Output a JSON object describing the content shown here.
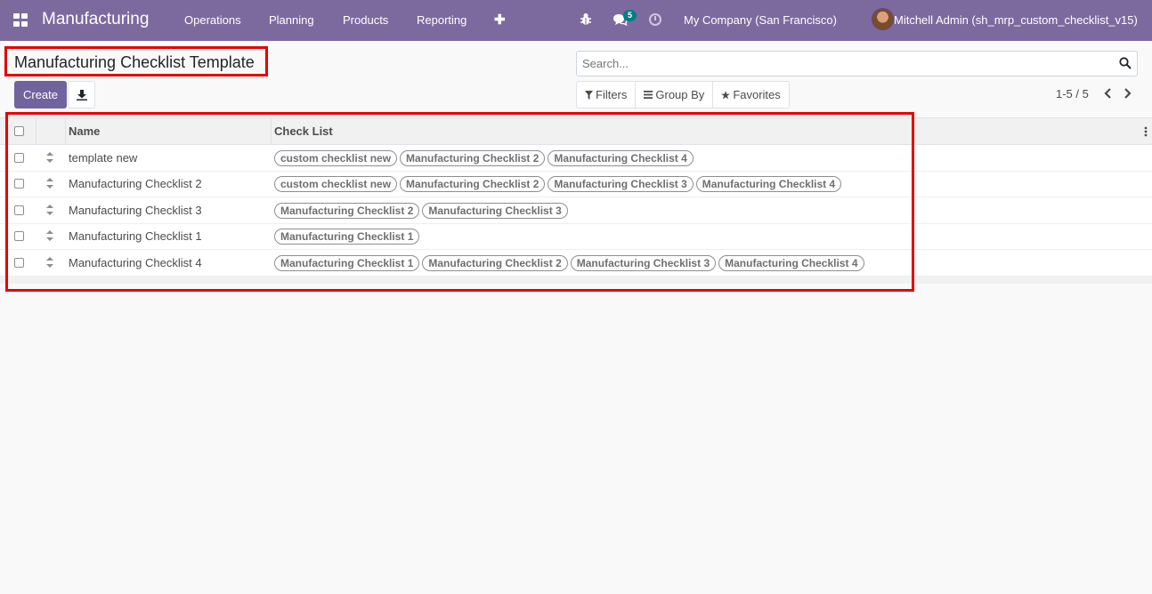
{
  "navbar": {
    "app_name": "Manufacturing",
    "menus": [
      "Operations",
      "Planning",
      "Products",
      "Reporting"
    ],
    "chat_count": "5",
    "company": "My Company (San Francisco)",
    "user": "Mitchell Admin (sh_mrp_custom_checklist_v15)"
  },
  "control_panel": {
    "title": "Manufacturing Checklist Template",
    "create_label": "Create",
    "search_placeholder": "Search...",
    "filters_label": "Filters",
    "group_by_label": "Group By",
    "favorites_label": "Favorites",
    "pager": "1-5 / 5"
  },
  "table": {
    "headers": {
      "name": "Name",
      "checklist": "Check List"
    },
    "rows": [
      {
        "name": "template new",
        "tags": [
          "custom checklist new",
          "Manufacturing Checklist 2",
          "Manufacturing Checklist 4"
        ]
      },
      {
        "name": "Manufacturing Checklist 2",
        "tags": [
          "custom checklist new",
          "Manufacturing Checklist 2",
          "Manufacturing Checklist 3",
          "Manufacturing Checklist 4"
        ]
      },
      {
        "name": "Manufacturing Checklist 3",
        "tags": [
          "Manufacturing Checklist 2",
          "Manufacturing Checklist 3"
        ]
      },
      {
        "name": "Manufacturing Checklist 1",
        "tags": [
          "Manufacturing Checklist 1"
        ]
      },
      {
        "name": "Manufacturing Checklist 4",
        "tags": [
          "Manufacturing Checklist 1",
          "Manufacturing Checklist 2",
          "Manufacturing Checklist 3",
          "Manufacturing Checklist 4"
        ]
      }
    ]
  },
  "colors": {
    "navbar": "#7c6a9f",
    "primary_button": "#71639e",
    "highlight": "#e60000"
  }
}
